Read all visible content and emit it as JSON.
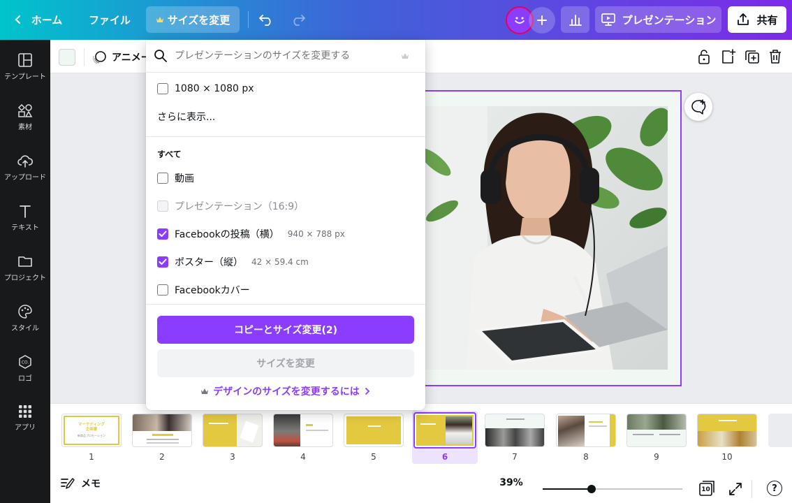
{
  "topbar": {
    "home": "ホーム",
    "file": "ファイル",
    "resize": "サイズを変更",
    "present": "プレゼンテーション",
    "share": "共有"
  },
  "sidebar": {
    "items": [
      {
        "label": "テンプレート",
        "icon": "template-icon"
      },
      {
        "label": "素材",
        "icon": "elements-icon"
      },
      {
        "label": "アップロード",
        "icon": "upload-icon"
      },
      {
        "label": "テキスト",
        "icon": "text-icon"
      },
      {
        "label": "プロジェクト",
        "icon": "folder-icon"
      },
      {
        "label": "スタイル",
        "icon": "palette-icon"
      },
      {
        "label": "ロゴ",
        "icon": "logo-icon"
      },
      {
        "label": "アプリ",
        "icon": "apps-icon"
      }
    ]
  },
  "toolbar": {
    "animate": "アニメート",
    "swatch_color": "#eef7f2"
  },
  "dropdown": {
    "search_placeholder": "プレゼンテーションのサイズを変更する",
    "custom_size": "1080 × 1080 px",
    "show_more": "さらに表示...",
    "section_all": "すべて",
    "options": [
      {
        "label": "動画",
        "dims": "",
        "checked": false,
        "disabled": false
      },
      {
        "label": "プレゼンテーション（16:9）",
        "dims": "",
        "checked": false,
        "disabled": true
      },
      {
        "label": "Facebookの投稿（横）",
        "dims": "940 × 788 px",
        "checked": true,
        "disabled": false
      },
      {
        "label": "ポスター（縦）",
        "dims": "42 × 59.4 cm",
        "checked": true,
        "disabled": false
      },
      {
        "label": "Facebookカバー",
        "dims": "",
        "checked": false,
        "disabled": false
      }
    ],
    "copy_resize": "コピーとサイズ変更(2)",
    "resize": "サイズを変更",
    "help_link": "デザインのサイズを変更するには"
  },
  "filmstrip": {
    "pages": [
      "1",
      "2",
      "3",
      "4",
      "5",
      "6",
      "7",
      "8",
      "9",
      "10"
    ],
    "selected": 6,
    "slide1_title": "マーケティング\n企画書",
    "slide1_sub": "新商品プロモーション"
  },
  "bottombar": {
    "notes": "メモ",
    "zoom": "39%",
    "zoom_fraction": 0.35,
    "page_count": "10"
  },
  "colors": {
    "accent": "#8b3dff",
    "accent_light": "#ede3ff",
    "slide_yellow": "#e3c93f",
    "sidebar_bg": "#18191b"
  }
}
